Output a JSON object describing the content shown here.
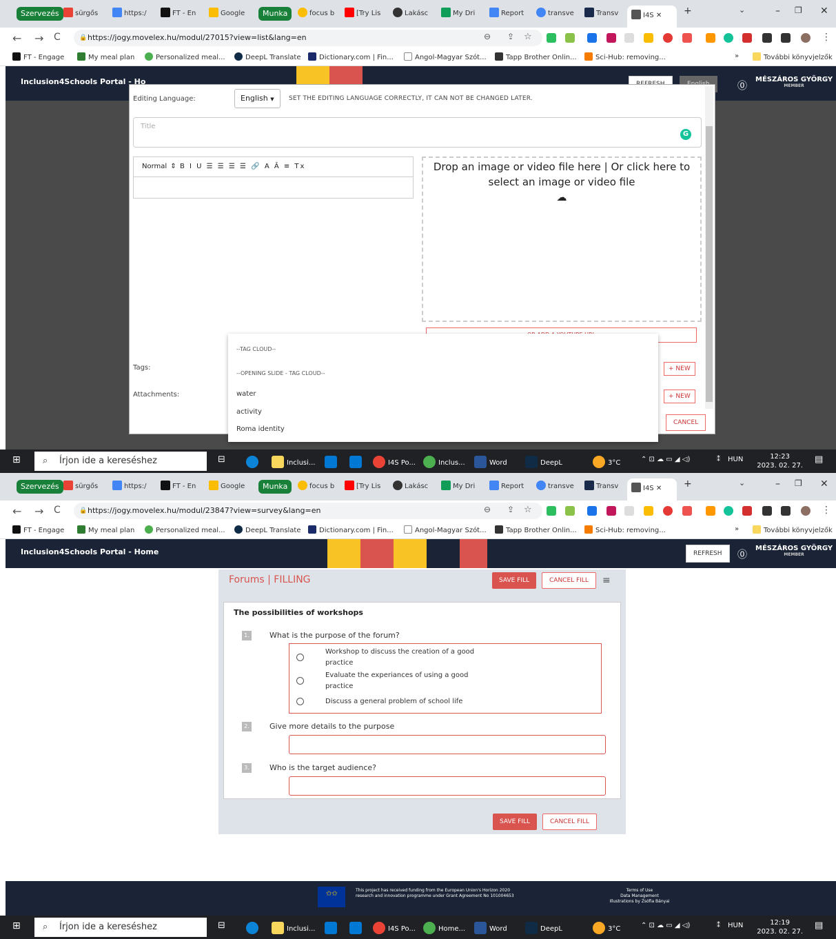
{
  "tabs": {
    "group_szervezes": "Szervezés",
    "group_munka": "Munka",
    "items": [
      "sürgős",
      "https:/",
      "FT - En",
      "Google",
      "focus b",
      "[Try Lis",
      "Lakásc",
      "My Dri",
      "Report",
      "transve",
      "Transv"
    ],
    "active": "I4S",
    "colors": {
      "szervezes": "#188038",
      "munka": "#188038"
    }
  },
  "shot1": {
    "url": "https://jogy.movelex.hu/modul/27015?view=list&lang=en"
  },
  "shot2": {
    "url": "https://jogy.movelex.hu/modul/23847?view=survey&lang=en"
  },
  "bookmarks": [
    "FT - Engage",
    "My meal plan",
    "Personalized meal...",
    "DeepL Translate",
    "Dictionary.com | Fin...",
    "Angol-Magyar Szót...",
    "Tapp Brother Onlin...",
    "Sci-Hub: removing...",
    "»",
    "További könyvjelzők"
  ],
  "app": {
    "title": "Inclusion4Schools Portal - Home",
    "title_short": "Inclusion4Schools Portal - Ho",
    "refresh": "REFRESH",
    "refresh_partial": "REFRESH",
    "lang": "English",
    "user": "MÉSZÁROS GYÖRGY",
    "role": "MEMBER"
  },
  "modal": {
    "editing_language_label": "Editing Language:",
    "editing_language_value": "English",
    "warning": "SET THE EDITING LANGUAGE CORRECTLY, IT CAN NOT BE CHANGED LATER.",
    "title_placeholder": "Title",
    "toolbar_style": "Normal",
    "toolbar_icons": "B I U  ☰ ☰ ☰ ☰  🔗  A Ā  ≡  Tx",
    "drop_text": "Drop an image or video file here | Or click here to select an image or video file",
    "youtube": "OR ADD A YOUTUBE URL",
    "tags_label": "Tags:",
    "attachments_label": "Attachments:",
    "new_label": "+ NEW",
    "cancel": "CANCEL"
  },
  "tag_dropdown": {
    "h1": "--TAG CLOUD--",
    "h2": "--OPENING SLIDE - TAG CLOUD--",
    "items": [
      "water",
      "activity",
      "Roma identity"
    ]
  },
  "taskbar": {
    "search": "Írjon ide a kereséshez",
    "apps1": [
      "Inclusi...",
      "I4S Po...",
      "Inclus...",
      "Word",
      "DeepL"
    ],
    "apps2": [
      "Inclusi...",
      "I4S Po...",
      "Home...",
      "Word",
      "DeepL"
    ],
    "temp": "3°C",
    "lang": "HUN",
    "time1": "12:23",
    "time2": "12:19",
    "date": "2023. 02. 27."
  },
  "form": {
    "header": "Forums | FILLING",
    "save": "SAVE FILL",
    "cancel": "CANCEL FILL",
    "title": "The possibilities of workshops",
    "q1": "What is the purpose of the forum?",
    "q1_opts": [
      "Workshop to discuss the creation of a good practice",
      "Evaluate the experiances of using a good practice",
      "Discuss a general problem of school life"
    ],
    "q2": "Give more details to the purpose",
    "q3": "Who is the target audience?",
    "nums": [
      "1.",
      "2.",
      "3."
    ]
  },
  "footer": {
    "funding": "This project has received funding from the European Union's Horizon 2020 research and innovation programme under Grant Agreement No 101004653",
    "terms": "Terms of Use",
    "data": "Data Management",
    "illus": "Illustrations by Zsófia Bányai"
  }
}
